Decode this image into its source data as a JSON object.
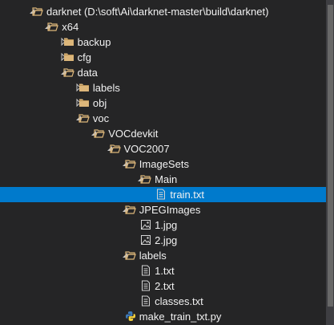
{
  "tree": {
    "items": [
      {
        "label": "darknet (D:\\soft\\Ai\\darknet-master\\build\\darknet)",
        "depth": 0,
        "kind": "folder",
        "state": "expanded"
      },
      {
        "label": "x64",
        "depth": 1,
        "kind": "folder",
        "state": "expanded"
      },
      {
        "label": "backup",
        "depth": 2,
        "kind": "folder",
        "state": "collapsed"
      },
      {
        "label": "cfg",
        "depth": 2,
        "kind": "folder",
        "state": "collapsed"
      },
      {
        "label": "data",
        "depth": 2,
        "kind": "folder",
        "state": "expanded"
      },
      {
        "label": "labels",
        "depth": 3,
        "kind": "folder",
        "state": "collapsed"
      },
      {
        "label": "obj",
        "depth": 3,
        "kind": "folder",
        "state": "collapsed"
      },
      {
        "label": "voc",
        "depth": 3,
        "kind": "folder",
        "state": "expanded"
      },
      {
        "label": "VOCdevkit",
        "depth": 4,
        "kind": "folder",
        "state": "expanded"
      },
      {
        "label": "VOC2007",
        "depth": 5,
        "kind": "folder",
        "state": "expanded"
      },
      {
        "label": "ImageSets",
        "depth": 6,
        "kind": "folder",
        "state": "expanded"
      },
      {
        "label": "Main",
        "depth": 7,
        "kind": "folder",
        "state": "expanded"
      },
      {
        "label": "train.txt",
        "depth": 8,
        "kind": "text-file",
        "state": "none",
        "selected": true
      },
      {
        "label": "JPEGImages",
        "depth": 6,
        "kind": "folder",
        "state": "expanded"
      },
      {
        "label": "1.jpg",
        "depth": 7,
        "kind": "image-file",
        "state": "none"
      },
      {
        "label": "2.jpg",
        "depth": 7,
        "kind": "image-file",
        "state": "none"
      },
      {
        "label": "labels",
        "depth": 6,
        "kind": "folder",
        "state": "expanded"
      },
      {
        "label": "1.txt",
        "depth": 7,
        "kind": "text-file",
        "state": "none"
      },
      {
        "label": "2.txt",
        "depth": 7,
        "kind": "text-file",
        "state": "none"
      },
      {
        "label": "classes.txt",
        "depth": 7,
        "kind": "text-file",
        "state": "none"
      },
      {
        "label": "make_train_txt.py",
        "depth": 6,
        "kind": "python-file",
        "state": "none"
      }
    ]
  },
  "colors": {
    "background": "#252526",
    "selection": "#007acc",
    "text": "#f1f1f1",
    "folder_outline": "#dcb67a",
    "caret": "#c8c8c8"
  },
  "icons": {
    "folder": "folder-icon",
    "text-file": "text-file-icon",
    "image-file": "image-file-icon",
    "python-file": "python-file-icon"
  }
}
